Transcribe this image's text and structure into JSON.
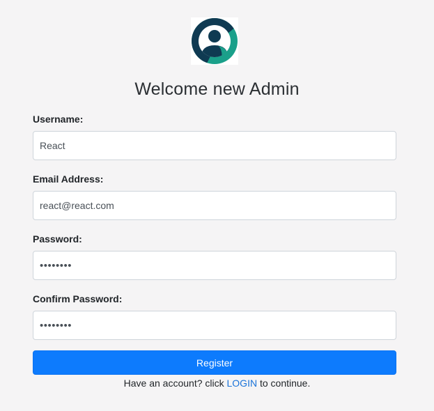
{
  "header": {
    "logo_icon": "user-avatar-icon",
    "title": "Welcome new Admin"
  },
  "form": {
    "username": {
      "label": "Username:",
      "value": "React"
    },
    "email": {
      "label": "Email Address:",
      "value": "react@react.com"
    },
    "password": {
      "label": "Password:",
      "value": "••••••••"
    },
    "confirm_password": {
      "label": "Confirm Password:",
      "value": "••••••••"
    },
    "register_label": "Register"
  },
  "footer": {
    "prefix": "Have an account? click ",
    "login_link": "LOGIN",
    "suffix": " to continue."
  },
  "colors": {
    "background": "#f5f4f5",
    "primary_button": "#0d7bfd",
    "link": "#1a73d9",
    "logo_teal": "#1aa08a",
    "logo_navy": "#0f3a52"
  }
}
